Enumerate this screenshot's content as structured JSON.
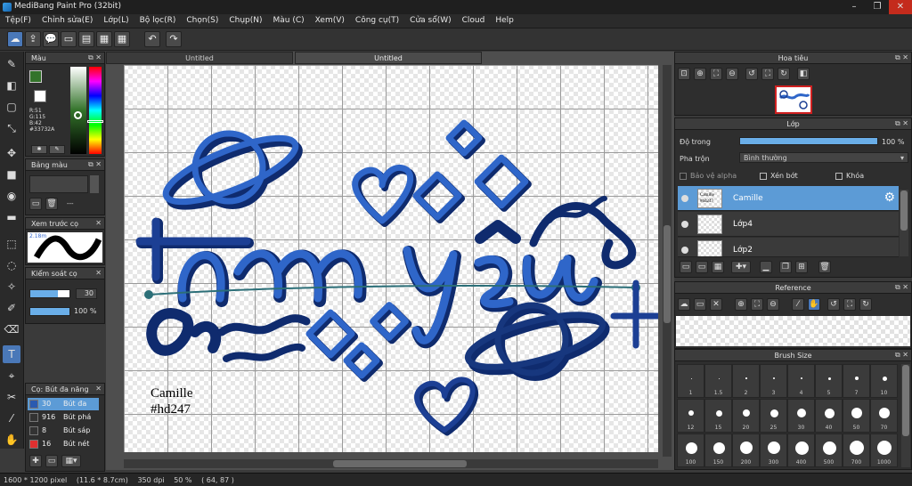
{
  "window": {
    "title": "MediBang Paint Pro (32bit)"
  },
  "menu": [
    "Tệp(F)",
    "Chỉnh sửa(E)",
    "Lớp(L)",
    "Bộ lọc(R)",
    "Chọn(S)",
    "Chụp(N)",
    "Màu (C)",
    "Xem(V)",
    "Công cụ(T)",
    "Cửa sổ(W)",
    "Cloud",
    "Help"
  ],
  "tabs": [
    {
      "label": "Untitled"
    },
    {
      "label": "Untitled"
    }
  ],
  "color_panel": {
    "title": "Màu",
    "r": "R:51",
    "g": "G:115",
    "b": "B:42",
    "hex": "#33732A",
    "fg": "#33732a"
  },
  "palette_panel": {
    "title": "Bảng màu",
    "value": "---"
  },
  "preview_panel": {
    "title": "Xem trước cọ",
    "size": "2.18m"
  },
  "control_panel": {
    "title": "Kiểm soát cọ",
    "size": "30",
    "opacity": "100 %"
  },
  "brush_list": {
    "title": "Cọ: Bút đa năng",
    "items": [
      {
        "size": "30",
        "label": "Bút đa",
        "color": "#2a5ab0",
        "selected": true
      },
      {
        "size": "916",
        "label": "Bút phá",
        "color": "#333",
        "selected": false
      },
      {
        "size": "8",
        "label": "Bút sáp",
        "color": "#333",
        "selected": false
      },
      {
        "size": "16",
        "label": "Bút nét",
        "color": "#e03030",
        "selected": false
      }
    ]
  },
  "canvas": {
    "text_note_1": "Camille",
    "text_note_2": "#hd247",
    "colors": {
      "blue": "#2f66c9",
      "navy": "#0f2b6e"
    }
  },
  "navigator": {
    "title": "Hoa tiêu"
  },
  "layer_panel": {
    "title": "Lớp",
    "opacity_label": "Độ trong",
    "opacity_value": "100 %",
    "blend_label": "Pha trộn",
    "blend_value": "Bình thường",
    "protect_alpha": "Bảo vệ alpha",
    "clipping": "Xén bớt",
    "lock": "Khóa",
    "layers": [
      {
        "name": "Camille",
        "thumb": "Camille #hd247",
        "selected": true
      },
      {
        "name": "Lớp4",
        "selected": false
      },
      {
        "name": "Lớp2",
        "selected": false
      }
    ]
  },
  "reference_panel": {
    "title": "Reference"
  },
  "brush_size_panel": {
    "title": "Brush Size",
    "sizes": [
      "1",
      "1.5",
      "2",
      "3",
      "4",
      "5",
      "7",
      "10",
      "12",
      "15",
      "20",
      "25",
      "30",
      "40",
      "50",
      "70",
      "100",
      "150",
      "200",
      "300",
      "400",
      "500",
      "700",
      "1000"
    ]
  },
  "status": {
    "dims": "1600 * 1200 pixel",
    "size_cm": "(11.6 * 8.7cm)",
    "dpi": "350 dpi",
    "zoom": "50 %",
    "coords": "( 64, 87 )"
  }
}
